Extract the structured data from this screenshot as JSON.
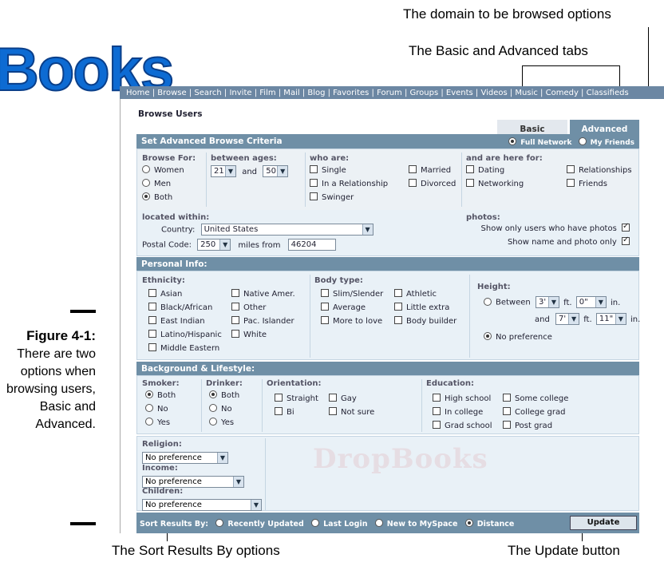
{
  "callouts": {
    "domain": "The domain to be browsed options",
    "tabs": "The Basic and Advanced tabs",
    "sort": "The Sort Results By options",
    "update": "The Update button"
  },
  "logo": "Books",
  "figure": {
    "label": "Figure 4-1:",
    "caption": "There are two options when browsing users, Basic and Advanced."
  },
  "topnav": "Home | Browse | Search | Invite | Film | Mail | Blog | Favorites | Forum | Groups | Events | Videos | Music | Comedy | Classifieds",
  "page_title": "Browse Users",
  "tabs": {
    "basic": "Basic",
    "advanced": "Advanced"
  },
  "criteria_header": "Set Advanced Browse Criteria",
  "network": {
    "full": "Full Network",
    "friends": "My Friends",
    "selected": "full"
  },
  "browse_for": {
    "label": "Browse For:",
    "options": [
      "Women",
      "Men",
      "Both"
    ],
    "selected": "Both"
  },
  "ages": {
    "label": "between ages:",
    "min": "21",
    "and": "and",
    "max": "50"
  },
  "who_are": {
    "label": "who are:",
    "options": [
      "Single",
      "Married",
      "In a Relationship",
      "Divorced",
      "Swinger"
    ]
  },
  "here_for": {
    "label": "and are here for:",
    "options": [
      "Dating",
      "Relationships",
      "Networking",
      "Friends"
    ]
  },
  "location": {
    "label": "located within:",
    "country_label": "Country:",
    "country": "United States",
    "postal_label": "Postal Code:",
    "distance": "250",
    "miles_from": "miles from",
    "postal_code": "46204"
  },
  "photos": {
    "label": "photos:",
    "only_photos": "Show only users who have photos",
    "name_photo": "Show name and photo only"
  },
  "personal_header": "Personal Info:",
  "ethnicity": {
    "label": "Ethnicity:",
    "col1": [
      "Asian",
      "Black/African",
      "East Indian",
      "Latino/Hispanic",
      "Middle Eastern"
    ],
    "col2": [
      "Native Amer.",
      "Other",
      "Pac. Islander",
      "White"
    ]
  },
  "body_type": {
    "label": "Body type:",
    "col1": [
      "Slim/Slender",
      "Average",
      "More to love"
    ],
    "col2": [
      "Athletic",
      "Little extra",
      "Body builder"
    ]
  },
  "height": {
    "label": "Height:",
    "between": "Between",
    "min_ft": "3'",
    "min_in": "0\"",
    "and": "and",
    "max_ft": "7'",
    "max_in": "11\"",
    "ft": "ft.",
    "in": "in.",
    "no_pref": "No preference"
  },
  "background_header": "Background & Lifestyle:",
  "smoker": {
    "label": "Smoker:",
    "options": [
      "Both",
      "No",
      "Yes"
    ]
  },
  "drinker": {
    "label": "Drinker:",
    "options": [
      "Both",
      "No",
      "Yes"
    ]
  },
  "orientation": {
    "label": "Orientation:",
    "options": [
      "Straight",
      "Gay",
      "Bi",
      "Not sure"
    ]
  },
  "education": {
    "label": "Education:",
    "options": [
      "High school",
      "Some college",
      "In college",
      "College grad",
      "Grad school",
      "Post grad"
    ]
  },
  "religion": {
    "label": "Religion:",
    "value": "No preference"
  },
  "income": {
    "label": "Income:",
    "value": "No preference"
  },
  "children": {
    "label": "Children:",
    "value": "No preference"
  },
  "watermark": "DropBooks",
  "sort": {
    "label": "Sort Results By:",
    "options": [
      "Recently Updated",
      "Last Login",
      "New to MySpace",
      "Distance"
    ],
    "selected": "Distance"
  },
  "update_button": "Update"
}
